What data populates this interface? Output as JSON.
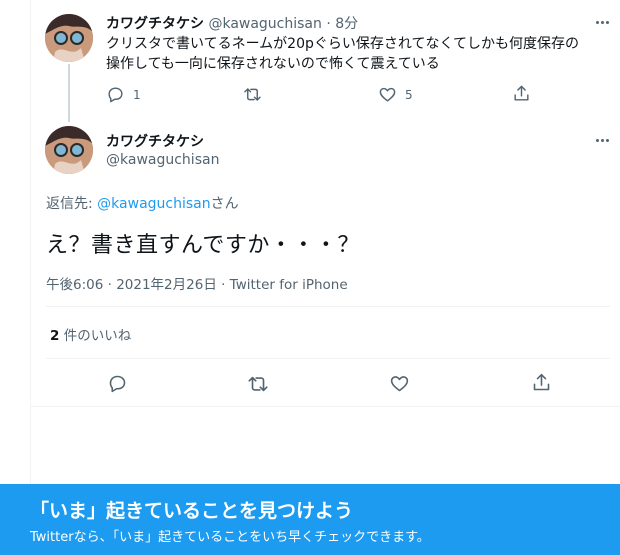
{
  "parent_tweet": {
    "display_name": "カワグチタケシ",
    "handle": "@kawaguchisan",
    "separator": "·",
    "time": "8分",
    "text_line1": "クリスタで書いてるネームが20pぐらい保存されてなくてしかも何度保存の",
    "text_line2": "操作しても一向に保存されないので怖くて震えている",
    "reply_count": "1",
    "like_count": "5"
  },
  "focused_tweet": {
    "display_name": "カワグチタケシ",
    "handle": "@kawaguchisan",
    "reply_to_label": "返信先: ",
    "reply_to_handle": "@kawaguchisan",
    "reply_to_suffix": "さん",
    "text": "え？書き直すんですか・・・？",
    "timestamp": "午後6:06 · 2021年2月26日 · Twitter for iPhone",
    "likes_count": "2",
    "likes_label": " 件のいいね"
  },
  "banner": {
    "title": "「いま」起きていることを見つけよう",
    "subtitle": "Twitterなら、「いま」起きていることをいち早くチェックできます。"
  },
  "icons": [
    "more-icon",
    "reply-icon",
    "retweet-icon",
    "like-icon",
    "share-icon"
  ],
  "colors": {
    "accent": "#1d9bf0",
    "text": "#0f1419",
    "muted": "#536471",
    "divider": "#eff3f4"
  }
}
